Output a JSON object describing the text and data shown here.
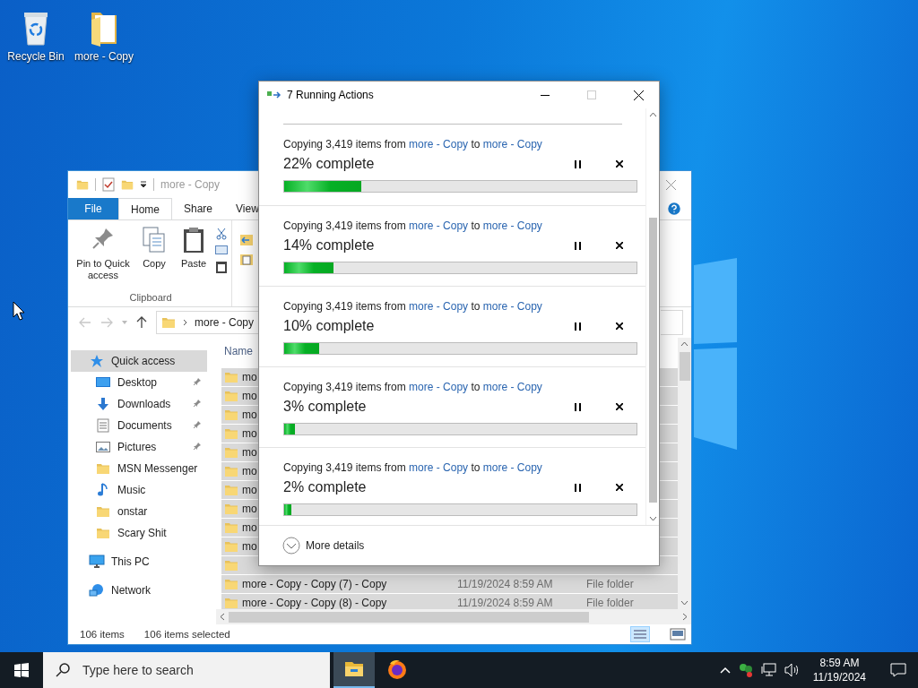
{
  "desktop_icons": [
    {
      "label": "Recycle Bin",
      "kind": "bin"
    },
    {
      "label": "more - Copy",
      "kind": "folder"
    }
  ],
  "explorer": {
    "title": "more - Copy",
    "ribbon_tabs": [
      {
        "label": "File",
        "kind": "file",
        "selected": false
      },
      {
        "label": "Home",
        "kind": "tab",
        "selected": true
      },
      {
        "label": "Share",
        "kind": "tab",
        "selected": false
      },
      {
        "label": "View",
        "kind": "tab",
        "selected": false
      }
    ],
    "ribbon_buttons": [
      {
        "label": "Pin to Quick access",
        "kind": "pin"
      },
      {
        "label": "Copy",
        "kind": "copy"
      },
      {
        "label": "Paste",
        "kind": "paste"
      }
    ],
    "ribbon_group": "Clipboard",
    "address": "more - Copy",
    "nav_pane": [
      {
        "label": "Quick access",
        "kind": "star",
        "selected": true,
        "children": [
          {
            "label": "Desktop",
            "kind": "desktop",
            "pinned": true
          },
          {
            "label": "Downloads",
            "kind": "download",
            "pinned": true
          },
          {
            "label": "Documents",
            "kind": "document",
            "pinned": true
          },
          {
            "label": "Pictures",
            "kind": "picture",
            "pinned": true
          },
          {
            "label": "MSN Messenger",
            "kind": "folder",
            "pinned": false
          },
          {
            "label": "Music",
            "kind": "music",
            "pinned": false
          },
          {
            "label": "onstar",
            "kind": "folder",
            "pinned": false
          },
          {
            "label": "Scary Shit",
            "kind": "folder",
            "pinned": false
          }
        ]
      },
      {
        "label": "This PC",
        "kind": "pc",
        "selected": false
      },
      {
        "label": "Network",
        "kind": "network",
        "selected": false
      }
    ],
    "column": "Name",
    "rows": [
      {
        "name": "mo",
        "selected": true
      },
      {
        "name": "mo",
        "selected": true
      },
      {
        "name": "mo",
        "selected": true
      },
      {
        "name": "mo",
        "selected": true
      },
      {
        "name": "mo",
        "selected": true
      },
      {
        "name": "mo",
        "selected": true
      },
      {
        "name": "mo",
        "selected": true
      },
      {
        "name": "mo",
        "selected": true
      },
      {
        "name": "mo",
        "selected": true
      },
      {
        "name": "mo",
        "selected": true
      },
      {
        "selected": true
      },
      {
        "name": "more - Copy - Copy (7) - Copy",
        "date": "11/19/2024 8:59 AM",
        "type": "File folder",
        "selected": true
      },
      {
        "name": "more - Copy - Copy (8) - Copy",
        "date": "11/19/2024 8:59 AM",
        "type": "File folder",
        "selected": true
      }
    ],
    "status": {
      "count": "106 items",
      "selection": "106 items selected"
    }
  },
  "dialog": {
    "title": "7 Running Actions",
    "actions": [
      {
        "prefix": "Copying 3,419 items from",
        "source": "more - Copy",
        "middle": "to",
        "destination": "more - Copy",
        "status": "22% complete",
        "level": 0.22
      },
      {
        "prefix": "Copying 3,419 items from",
        "source": "more - Copy",
        "middle": "to",
        "destination": "more - Copy",
        "status": "14% complete",
        "level": 0.14
      },
      {
        "prefix": "Copying 3,419 items from",
        "source": "more - Copy",
        "middle": "to",
        "destination": "more - Copy",
        "status": "10% complete",
        "level": 0.1
      },
      {
        "prefix": "Copying 3,419 items from",
        "source": "more - Copy",
        "middle": "to",
        "destination": "more - Copy",
        "status": "3% complete",
        "level": 0.03
      },
      {
        "prefix": "Copying 3,419 items from",
        "source": "more - Copy",
        "middle": "to",
        "destination": "more - Copy",
        "status": "2% complete",
        "level": 0.02
      }
    ],
    "more_details": "More details"
  },
  "taskbar": {
    "search_placeholder": "Type here to search",
    "apps": [
      {
        "kind": "explorer",
        "active": true
      },
      {
        "kind": "firefox",
        "active": false
      }
    ],
    "time": "8:59 AM",
    "date": "11/19/2024"
  }
}
